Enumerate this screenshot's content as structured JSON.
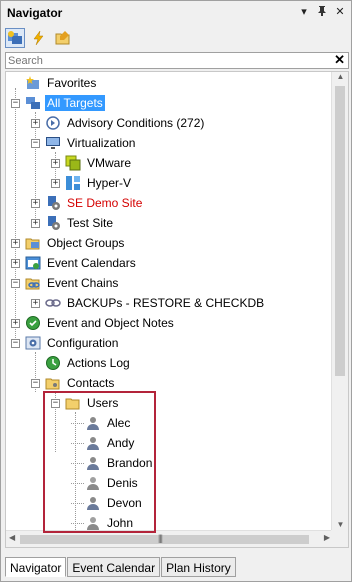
{
  "panel": {
    "title": "Navigator",
    "title_buttons": [
      "▾",
      "📌",
      "✕"
    ]
  },
  "toolbar": {
    "icons": [
      "targets-icon",
      "events-icon",
      "folder-edit-icon"
    ]
  },
  "search": {
    "placeholder": "Search",
    "clear_label": "✕"
  },
  "tree": {
    "favorites": "Favorites",
    "all_targets": "All Targets",
    "advisory_conditions": "Advisory Conditions (272)",
    "virtualization": "Virtualization",
    "vmware": "VMware",
    "hyperv": "Hyper-V",
    "se_demo_site": "SE Demo Site",
    "test_site": "Test Site",
    "object_groups": "Object Groups",
    "event_calendars": "Event Calendars",
    "event_chains": "Event Chains",
    "backups": "BACKUPs - RESTORE & CHECKDB",
    "event_notes": "Event and Object Notes",
    "configuration": "Configuration",
    "actions_log": "Actions Log",
    "contacts": "Contacts",
    "users": "Users",
    "user_list": [
      "Alec",
      "Andy",
      "Brandon",
      "Denis",
      "Devon",
      "John"
    ]
  },
  "tabs": [
    "Navigator",
    "Event Calendar",
    "Plan History"
  ],
  "colors": {
    "selection": "#3399ff",
    "highlight_box": "#b3243a",
    "red_text": "#d40000"
  }
}
